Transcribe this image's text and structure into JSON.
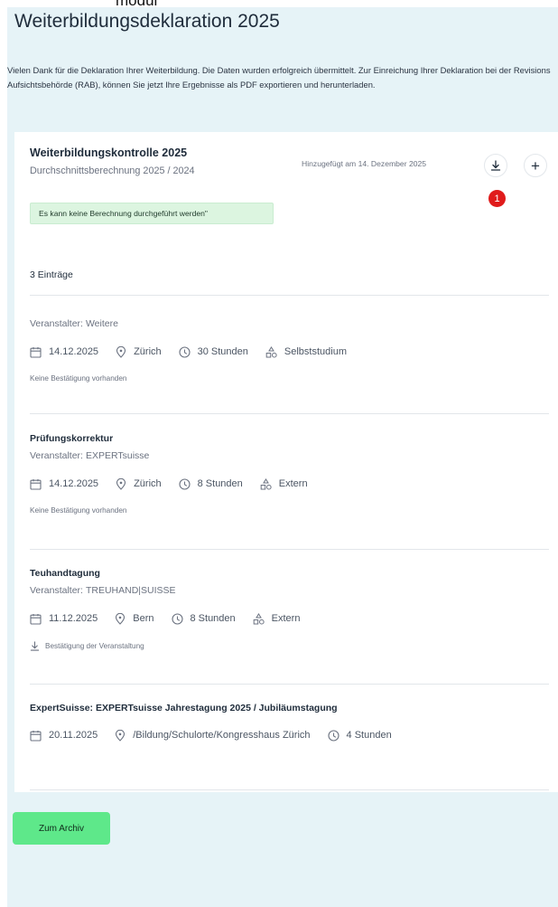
{
  "top_fragment": "modul",
  "page": {
    "title": "Weiterbildungsdeklaration 2025",
    "intro": "Vielen Dank für die Deklaration Ihrer Weiterbildung. Die Daten wurden erfolgreich übermittelt. Zur Einreichung Ihrer Deklaration bei der Revisions Aufsichtsbehörde (RAB), können Sie jetzt Ihre Ergebnisse als PDF exportieren und herunterladen."
  },
  "card": {
    "title": "Weiterbildungskontrolle 2025",
    "subtitle": "Durchschnittsberechnung 2025 / 2024",
    "added_label": "Hinzugefügt am 14. Dezember 2025",
    "download_icon": "download-icon",
    "add_icon": "plus-icon",
    "add_symbol": "+",
    "badge_count": "1",
    "badge_color": "#e01b1b",
    "warning": "Es kann keine Berechnung durchgeführt werden\"",
    "entries_count": "3 Einträge"
  },
  "organizer_label": "Veranstalter:",
  "entries": [
    {
      "title": "",
      "organizer": "Weitere",
      "date": "14.12.2025",
      "location": "Zürich",
      "hours": "30 Stunden",
      "type": "Selbststudium",
      "note": "Keine Bestätigung vorhanden"
    },
    {
      "title": "Prüfungskorrektur",
      "organizer": "EXPERTsuisse",
      "date": "14.12.2025",
      "location": "Zürich",
      "hours": "8 Stunden",
      "type": "Extern",
      "note": "Keine Bestätigung vorhanden"
    },
    {
      "title": "Teuhandtagung",
      "organizer": "TREUHAND|SUISSE",
      "date": "11.12.2025",
      "location": "Bern",
      "hours": "8 Stunden",
      "type": "Extern",
      "note": "Bestätigung der Veranstaltung"
    },
    {
      "title": "ExpertSuisse: EXPERTsuisse Jahrestagung 2025 / Jubiläumstagung",
      "date": "20.11.2025",
      "location": "/Bildung/Schulorte/Kongresshaus Zürich",
      "hours": "4 Stunden"
    }
  ],
  "archive_button": "Zum Archiv",
  "colors": {
    "page_background": "#e6f3f7",
    "card_background": "#ffffff",
    "warning_background": "#dcf5e0",
    "archive_button": "#5ee88a"
  }
}
